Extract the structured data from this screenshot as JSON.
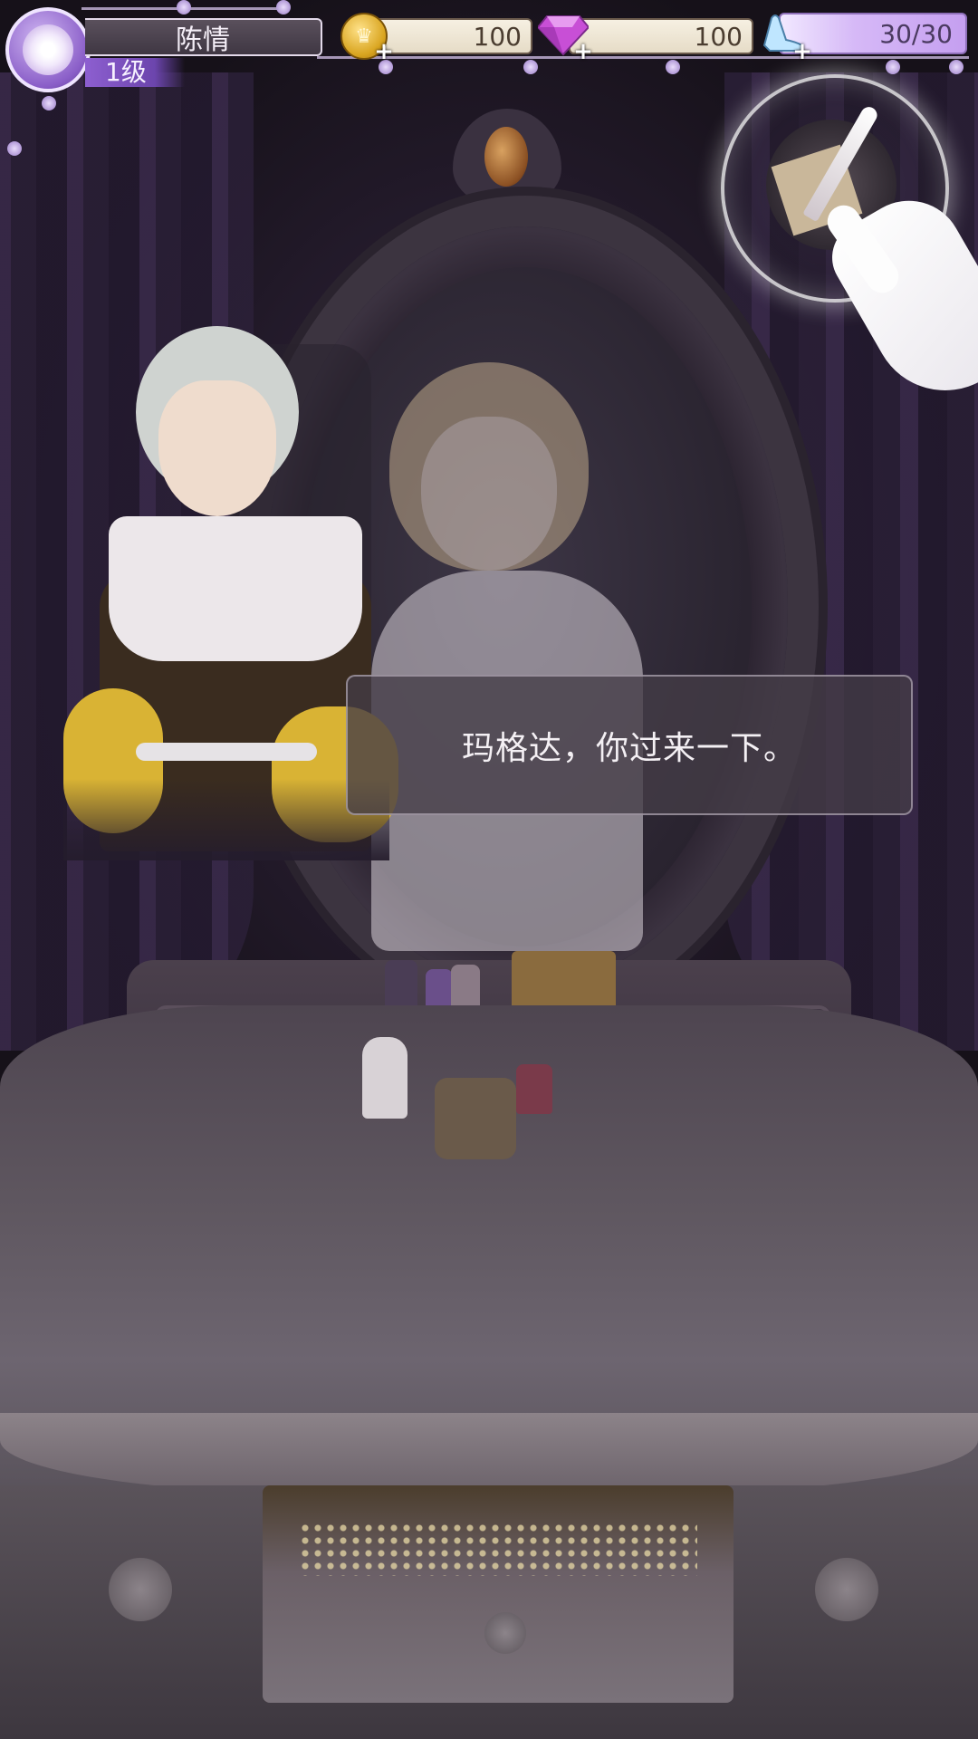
{
  "player": {
    "name": "陈情",
    "level": "1级"
  },
  "resources": {
    "gold": {
      "value": "100",
      "icon": "crown-coin-icon"
    },
    "diamond": {
      "value": "100",
      "icon": "diamond-icon"
    },
    "stamina": {
      "value": "30/30",
      "icon": "glass-slipper-icon"
    }
  },
  "quest_button": {
    "icon": "letter-quill-icon"
  },
  "dialogue": {
    "text": "玛格达，你过来一下。"
  },
  "colors": {
    "accent_purple": "#8d5fd0",
    "dialog_bg": "#443c46",
    "gold": "#d9a520"
  }
}
